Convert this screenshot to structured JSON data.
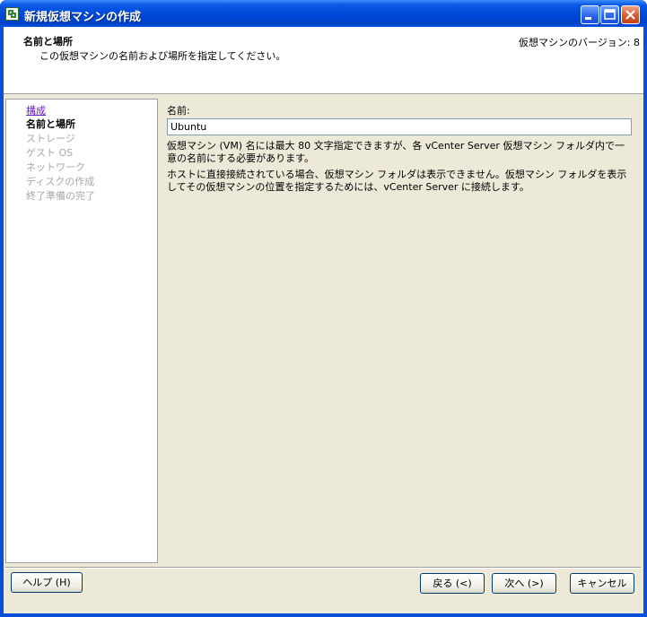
{
  "window": {
    "title": "新規仮想マシンの作成"
  },
  "header": {
    "title": "名前と場所",
    "subtitle": "この仮想マシンの名前および場所を指定してください。",
    "version": "仮想マシンのバージョン: 8"
  },
  "nav": {
    "items": [
      {
        "label": "構成",
        "state": "link"
      },
      {
        "label": "名前と場所",
        "state": "current"
      },
      {
        "label": "ストレージ",
        "state": "disabled"
      },
      {
        "label": "ゲスト OS",
        "state": "disabled"
      },
      {
        "label": "ネットワーク",
        "state": "disabled"
      },
      {
        "label": "ディスクの作成",
        "state": "disabled"
      },
      {
        "label": "終了準備の完了",
        "state": "disabled"
      }
    ]
  },
  "main": {
    "name_label": "名前:",
    "name_value": "Ubuntu",
    "paragraph1": "仮想マシン (VM) 名には最大 80 文字指定できますが、各 vCenter Server 仮想マシン フォルダ内で一意の名前にする必要があります。",
    "paragraph2": "ホストに直接接続されている場合、仮想マシン フォルダは表示できません。仮想マシン フォルダを表示してその仮想マシンの位置を指定するためには、vCenter Server に接続します。"
  },
  "footer": {
    "help_label": "ヘルプ (H)",
    "back_label": "戻る (<)",
    "next_label": "次へ (>)",
    "cancel_label": "キャンセル"
  },
  "colors": {
    "titlebar": "#0a5ae6",
    "dialog_bg": "#ece9d8",
    "link": "#6a1fc8",
    "disabled_text": "#a8a8a8"
  }
}
